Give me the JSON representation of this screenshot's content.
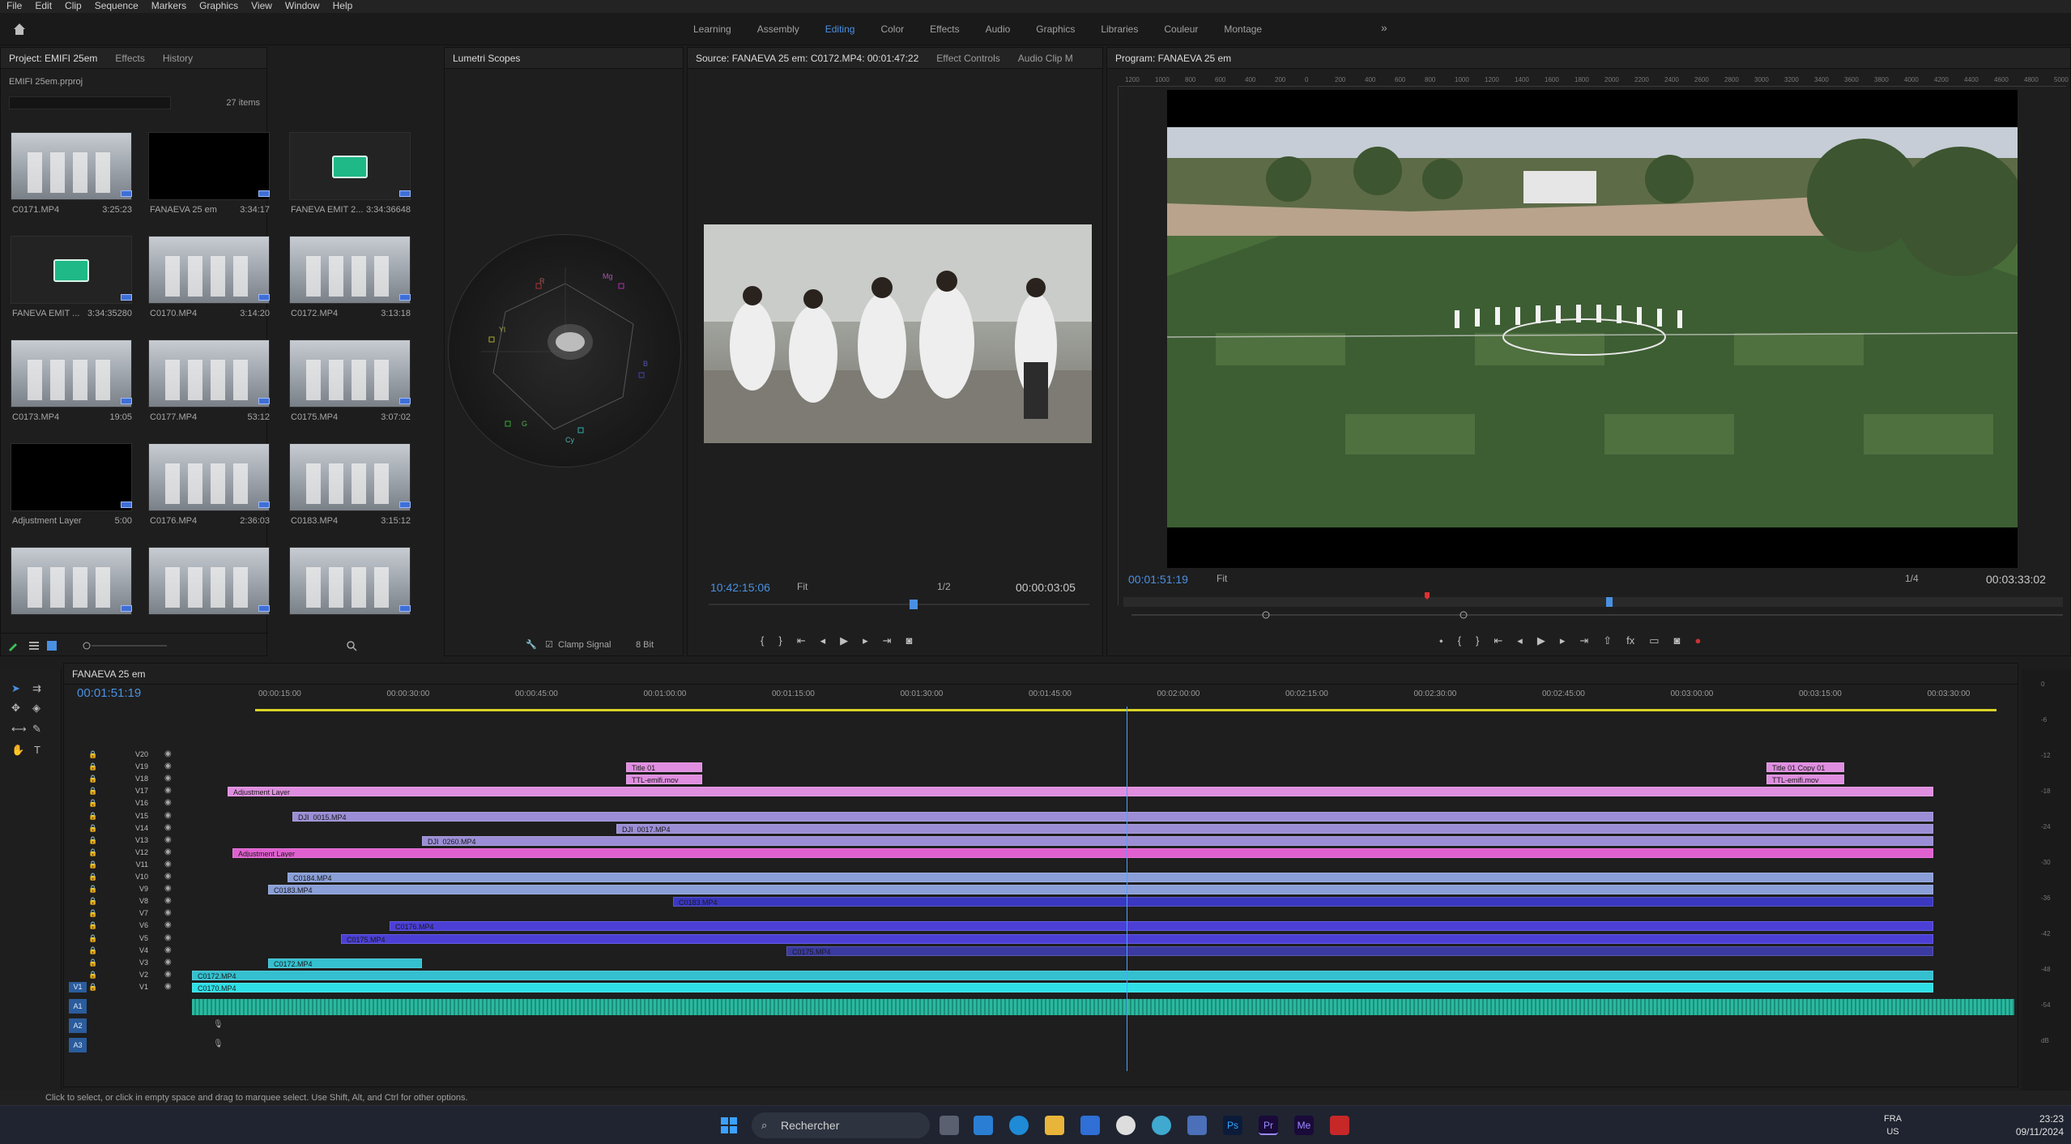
{
  "menu": [
    "File",
    "Edit",
    "Clip",
    "Sequence",
    "Markers",
    "Graphics",
    "View",
    "Window",
    "Help"
  ],
  "workspaces": {
    "tabs": [
      "Learning",
      "Assembly",
      "Editing",
      "Color",
      "Effects",
      "Audio",
      "Graphics",
      "Libraries",
      "Couleur",
      "Montage"
    ],
    "active": "Editing",
    "more": "»"
  },
  "project": {
    "tabs": [
      "Project: EMIFI 25em",
      "Effects",
      "History"
    ],
    "file": "EMIFI 25em.prproj",
    "count": "27 items",
    "items": [
      {
        "name": "C0171.MP4",
        "duration": "3:25:23",
        "kind": "video"
      },
      {
        "name": "FANAEVA 25 em",
        "duration": "3:34:17",
        "kind": "sequence"
      },
      {
        "name": "FANEVA EMIT 2...",
        "duration": "3:34:36648",
        "kind": "audio"
      },
      {
        "name": "FANEVA EMIT ...",
        "duration": "3:34:35280",
        "kind": "audio"
      },
      {
        "name": "C0170.MP4",
        "duration": "3:14:20",
        "kind": "video"
      },
      {
        "name": "C0172.MP4",
        "duration": "3:13:18",
        "kind": "video"
      },
      {
        "name": "C0173.MP4",
        "duration": "19:05",
        "kind": "video"
      },
      {
        "name": "C0177.MP4",
        "duration": "53:12",
        "kind": "video"
      },
      {
        "name": "C0175.MP4",
        "duration": "3:07:02",
        "kind": "video"
      },
      {
        "name": "Adjustment Layer",
        "duration": "5:00",
        "kind": "black"
      },
      {
        "name": "C0176.MP4",
        "duration": "2:36:03",
        "kind": "video"
      },
      {
        "name": "C0183.MP4",
        "duration": "3:15:12",
        "kind": "video"
      },
      {
        "name": "",
        "duration": "",
        "kind": "video"
      },
      {
        "name": "",
        "duration": "",
        "kind": "video"
      },
      {
        "name": "",
        "duration": "",
        "kind": "video"
      }
    ]
  },
  "lumetri": {
    "title": "Lumetri Scopes",
    "clamp_label": "Clamp Signal",
    "bit_depth": "8 Bit",
    "vectorscope_labels": [
      "R",
      "Mg",
      "B",
      "Cy",
      "G",
      "Yl"
    ]
  },
  "source": {
    "tabs": [
      "Source: FANAEVA 25 em: C0172.MP4: 00:01:47:22",
      "Effect Controls",
      "Audio Clip M"
    ],
    "timecode": "10:42:15:06",
    "zoom": "Fit",
    "quality": "1/2",
    "duration": "00:00:03:05"
  },
  "program": {
    "title": "Program: FANAEVA 25 em",
    "timecode": "00:01:51:19",
    "zoom": "Fit",
    "quality": "1/4",
    "duration": "00:03:33:02",
    "ruler_labels": [
      "1200",
      "1000",
      "800",
      "600",
      "400",
      "200",
      "0",
      "200",
      "400",
      "600",
      "800",
      "1000",
      "1200",
      "1400",
      "1600",
      "1800",
      "2000",
      "2200",
      "2400",
      "2600",
      "2800",
      "3000",
      "3200",
      "3400",
      "3600",
      "3800",
      "4000",
      "4200",
      "4400",
      "4600",
      "4800",
      "5000"
    ]
  },
  "timeline": {
    "title": "FANAEVA 25 em",
    "timecode": "00:01:51:19",
    "ruler": [
      "00:00:15:00",
      "00:00:30:00",
      "00:00:45:00",
      "00:01:00:00",
      "00:01:15:00",
      "00:01:30:00",
      "00:01:45:00",
      "00:02:00:00",
      "00:02:15:00",
      "00:02:30:00",
      "00:02:45:00",
      "00:03:00:00",
      "00:03:15:00",
      "00:03:30:00"
    ],
    "video_tracks": [
      "V20",
      "V19",
      "V18",
      "V17",
      "V16",
      "V15",
      "V14",
      "V13",
      "V12",
      "V11",
      "V10",
      "V9",
      "V8",
      "V7",
      "V6",
      "V5",
      "V4",
      "V3",
      "V2",
      "V1"
    ],
    "audio_tracks": [
      "A1",
      "A2",
      "A3"
    ],
    "source_patch": "V1",
    "clips": {
      "title": "Title 01",
      "title_copy": "Title 01 Copy 01",
      "ttl": "TTL-emifi.mov",
      "adjustment": "Adjustment Layer",
      "dji15": "DJI_0015.MP4",
      "dji17": "DJI_0017.MP4",
      "dji": "DJI_0260.MP4",
      "c0184": "C0184.MP4",
      "c0183": "C0183.MP4",
      "c0176": "C0176.MP4",
      "c0175": "C0175.MP4",
      "c0172": "C0172.MP4",
      "c0170": "C0170.MP4"
    },
    "meter_scale": [
      "0",
      "-6",
      "-12",
      "-18",
      "-24",
      "-30",
      "-36",
      "-42",
      "-48",
      "-54",
      "dB"
    ]
  },
  "status": "Click to select, or click in empty space and drag to marquee select. Use Shift, Alt, and Ctrl for other options.",
  "taskbar": {
    "search": "Rechercher",
    "lang": "FRA",
    "region": "US",
    "time": "23:23",
    "date": "09/11/2024"
  },
  "colors": {
    "accent": "#4a90e2",
    "clip_title": "#e08ee0",
    "clip_adjust": "#e060d0",
    "clip_dji": "#9b8ed6",
    "clip_c0184": "#8a9fd8",
    "clip_c0176": "#4b3fd6",
    "clip_v2": "#34c0d0",
    "clip_v1": "#2ee0e6",
    "audio": "#2ab9a0"
  }
}
